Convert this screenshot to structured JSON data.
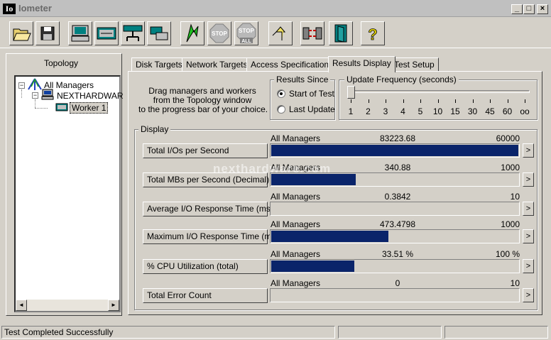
{
  "window": {
    "icon_text": "Io",
    "title": "Iometer",
    "minimize": "_",
    "maximize": "□",
    "close": "×"
  },
  "toolbar": [
    {
      "name": "open-config-button",
      "icon": "folder-open-icon"
    },
    {
      "name": "save-config-button",
      "icon": "floppy-disk-icon"
    },
    {
      "name": "show-results-button",
      "icon": "computer-monitor-icon"
    },
    {
      "name": "new-disk-worker-button",
      "icon": "disk-worker-icon"
    },
    {
      "name": "new-network-worker-button",
      "icon": "network-worker-icon"
    },
    {
      "name": "duplicate-worker-button",
      "icon": "duplicate-worker-icon"
    },
    {
      "name": "start-tests-button",
      "icon": "green-flag-icon"
    },
    {
      "name": "stop-button",
      "icon": "stop-sign-icon",
      "label": "STOP"
    },
    {
      "name": "stop-all-button",
      "icon": "stop-all-sign-icon",
      "label": "STOP",
      "sublabel": "ALL"
    },
    {
      "name": "reset-workers-button",
      "icon": "reset-arrow-icon"
    },
    {
      "name": "disconnect-button",
      "icon": "disconnect-icon"
    },
    {
      "name": "exit-button",
      "icon": "exit-door-icon"
    },
    {
      "name": "help-button",
      "icon": "question-mark-icon",
      "label": "?"
    }
  ],
  "topology": {
    "title": "Topology",
    "items": [
      {
        "label": "All Managers",
        "expander": "−"
      },
      {
        "label": "NEXTHARDWAR",
        "expander": "−"
      },
      {
        "label": "Worker 1"
      }
    ],
    "scroll_left": "◄",
    "scroll_right": "►"
  },
  "tabs": [
    {
      "label": "Disk Targets"
    },
    {
      "label": "Network Targets"
    },
    {
      "label": "Access Specifications"
    },
    {
      "label": "Results Display",
      "active": true
    },
    {
      "label": "Test Setup"
    }
  ],
  "instructions": {
    "line1": "Drag managers and workers",
    "line2": "from the Topology window",
    "line3": "to the progress bar of your choice."
  },
  "results_since": {
    "title": "Results Since",
    "options": [
      {
        "label": "Start of Test",
        "selected": true
      },
      {
        "label": "Last Update",
        "selected": false
      }
    ]
  },
  "update_frequency": {
    "title": "Update Frequency (seconds)",
    "ticks": [
      "1",
      "2",
      "3",
      "4",
      "5",
      "10",
      "15",
      "30",
      "45",
      "60",
      "oo"
    ],
    "selected": "1"
  },
  "display": {
    "title": "Display",
    "arrow": ">",
    "metrics": [
      {
        "label": "Total I/Os per Second",
        "source": "All Managers",
        "value": "83223.68",
        "max": "60000",
        "fill": 1.0
      },
      {
        "label": "Total MBs per Second (Decimal)",
        "source": "All Managers",
        "value": "340.88",
        "max": "1000",
        "fill": 0.341
      },
      {
        "label": "Average I/O Response Time (ms)",
        "source": "All Managers",
        "value": "0.3842",
        "max": "10",
        "fill": 0.0
      },
      {
        "label": "Maximum I/O Response Time (ms)",
        "source": "All Managers",
        "value": "473.4798",
        "max": "1000",
        "fill": 0.473
      },
      {
        "label": "% CPU Utilization (total)",
        "source": "All Managers",
        "value": "33.51 %",
        "max": "100 %",
        "fill": 0.335
      },
      {
        "label": "Total Error Count",
        "source": "All Managers",
        "value": "0",
        "max": "10",
        "fill": 0.0
      }
    ]
  },
  "watermark": "nexthardware.com",
  "status": {
    "message": "Test Completed Successfully"
  },
  "colors": {
    "bar": "#0a246a",
    "face": "#d4d0c8"
  }
}
